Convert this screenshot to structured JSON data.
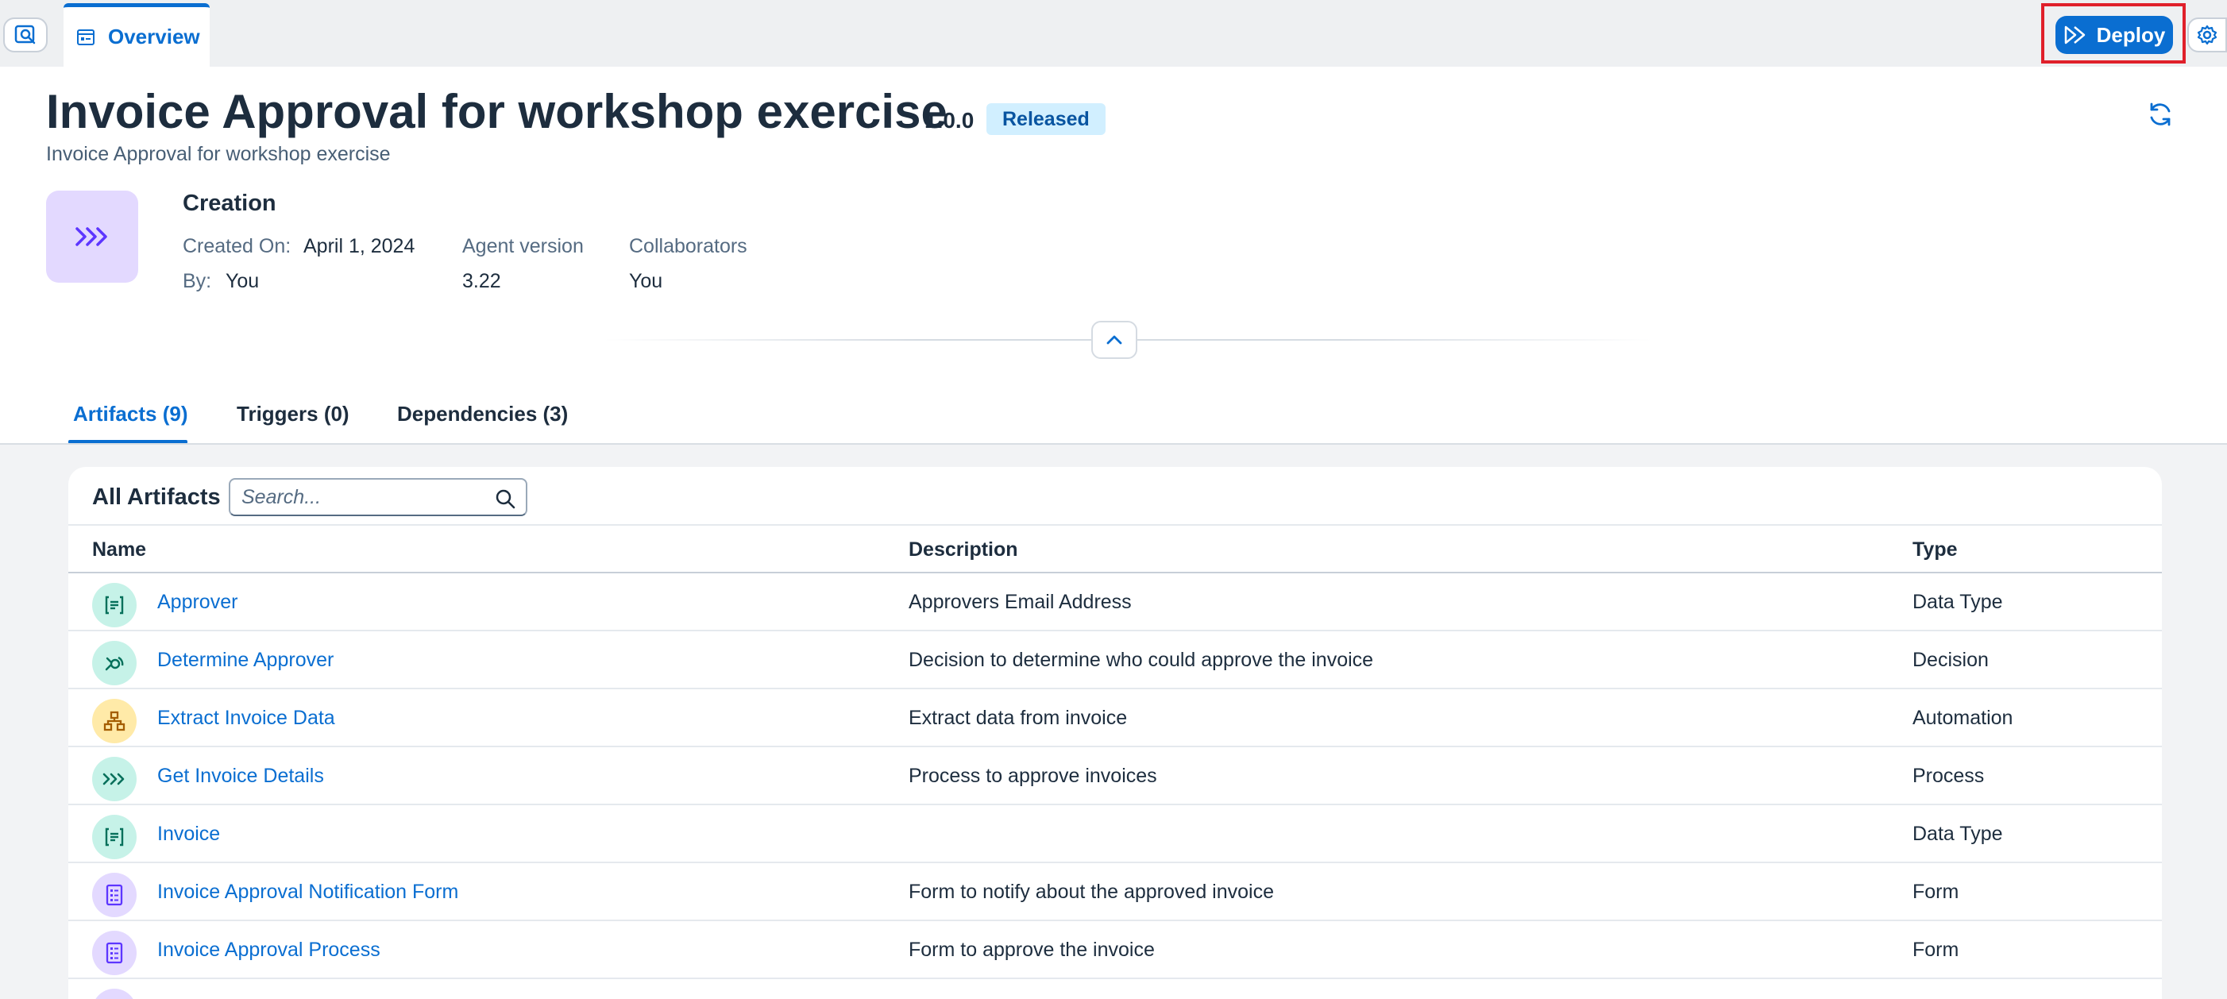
{
  "topbar": {
    "search_toggle_icon": "search-object-icon",
    "overview_tab_icon": "overview-icon",
    "overview_tab_label": "Overview",
    "deploy_label": "Deploy",
    "deploy_icon": "deploy-icon",
    "settings_icon": "gear-icon"
  },
  "header": {
    "title": "Invoice Approval for workshop exercise",
    "version": "1.0.0",
    "status": "Released",
    "subtitle": "Invoice Approval for workshop exercise",
    "refresh_icon": "refresh-icon",
    "tile_icon": "process-chevrons-icon",
    "creation_title": "Creation",
    "created_on_label": "Created On:",
    "created_on_value": "April 1, 2024",
    "by_label": "By:",
    "by_value": "You",
    "agent_version_label": "Agent version",
    "agent_version_value": "3.22",
    "collaborators_label": "Collaborators",
    "collaborators_value": "You",
    "collapse_icon": "chevron-up-icon"
  },
  "tabs": [
    {
      "label": "Artifacts (9)",
      "active": true
    },
    {
      "label": "Triggers (0)",
      "active": false
    },
    {
      "label": "Dependencies (3)",
      "active": false
    }
  ],
  "artifacts": {
    "title": "All Artifacts",
    "search_placeholder": "Search...",
    "columns": [
      "Name",
      "Description",
      "Type"
    ],
    "rows": [
      {
        "icon": "data-type-icon",
        "color": "teal",
        "name": "Approver",
        "description": "Approvers Email Address",
        "type": "Data Type"
      },
      {
        "icon": "decision-icon",
        "color": "teal",
        "name": "Determine Approver",
        "description": "Decision to determine who could approve the invoice",
        "type": "Decision"
      },
      {
        "icon": "automation-icon",
        "color": "yellow",
        "name": "Extract Invoice Data",
        "description": "Extract data from invoice",
        "type": "Automation"
      },
      {
        "icon": "process-icon",
        "color": "teal",
        "name": "Get Invoice Details",
        "description": "Process to approve invoices",
        "type": "Process"
      },
      {
        "icon": "data-type-icon",
        "color": "teal",
        "name": "Invoice",
        "description": "",
        "type": "Data Type"
      },
      {
        "icon": "form-icon",
        "color": "purple",
        "name": "Invoice Approval Notification Form",
        "description": "Form to notify about the approved invoice",
        "type": "Form"
      },
      {
        "icon": "form-icon",
        "color": "purple",
        "name": "Invoice Approval Process",
        "description": "Form to approve the invoice",
        "type": "Form"
      }
    ]
  },
  "colors": {
    "accent": "#0a6ed1",
    "highlight_box": "#e0202b",
    "status_bg": "#d1efff"
  }
}
